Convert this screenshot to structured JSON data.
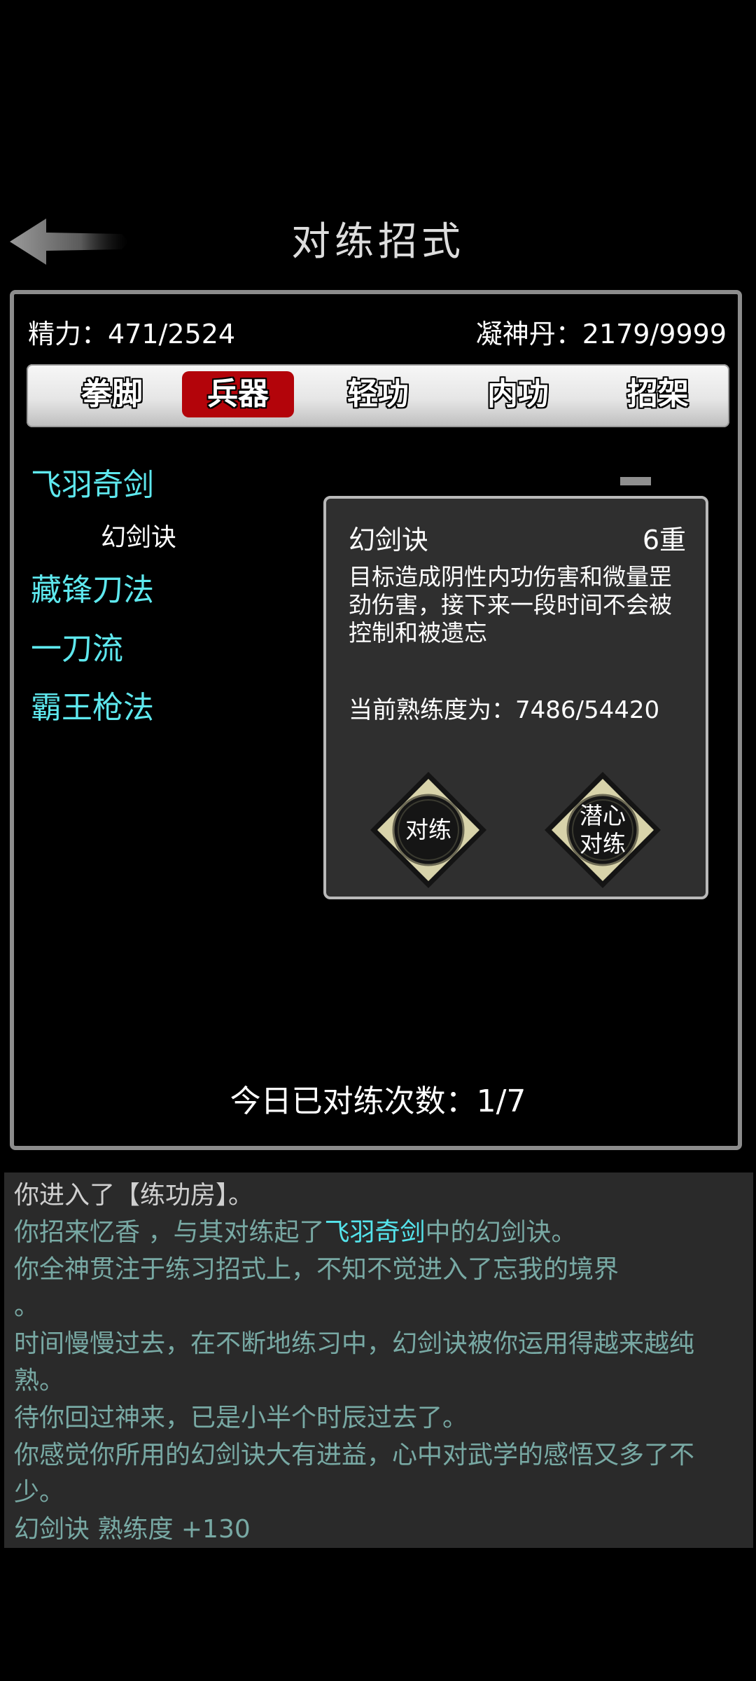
{
  "header": {
    "title": "对练招式",
    "back_icon": "back-arrow-icon"
  },
  "stats": {
    "energy_label": "精力：",
    "energy_value": "471/2524",
    "pill_label": "凝神丹：",
    "pill_value": "2179/9999"
  },
  "tabs": [
    {
      "label": "拳脚",
      "active": false
    },
    {
      "label": "兵器",
      "active": true
    },
    {
      "label": "轻功",
      "active": false
    },
    {
      "label": "内功",
      "active": false
    },
    {
      "label": "招架",
      "active": false
    }
  ],
  "skills": [
    {
      "name": "飞羽奇剑",
      "sub": "幻剑诀"
    },
    {
      "name": "藏锋刀法"
    },
    {
      "name": "一刀流"
    },
    {
      "name": "霸王枪法"
    }
  ],
  "detail": {
    "name": "幻剑诀",
    "level": "6重",
    "description": "目标造成阴性内功伤害和微量罡劲伤害，接下来一段时间不会被控制和被遗忘",
    "proficiency_label": "当前熟练度为：",
    "proficiency_value": "7486/54420",
    "proficiency_fraction": 0.1376,
    "buttons": {
      "spar": "对练",
      "focused_spar": "潜心\n对练"
    }
  },
  "daily": {
    "label": "今日已对练次数：",
    "value": "1/7"
  },
  "log": {
    "line1": "你进入了【练功房】。",
    "line2_a": "你招来忆香 ，与其对练起了",
    "line2_hl": "飞羽奇剑",
    "line2_b": "中的幻剑诀。",
    "line3": "你全神贯注于练习招式上，不知不觉进入了忘我的境界",
    "line3_b": "。",
    "line4": "时间慢慢过去，在不断地练习中，幻剑诀被你运用得越来越纯熟。",
    "line5": "待你回过神来，已是小半个时辰过去了。",
    "line6": "你感觉你所用的幻剑诀大有进益，心中对武学的感悟又多了不少。",
    "line7": "幻剑诀 熟练度 +130"
  },
  "colors": {
    "accent_cyan": "#5ee8ee",
    "tab_active": "#b3040a",
    "log_text": "#78a9a4",
    "button_face": "#d8d3aa"
  }
}
